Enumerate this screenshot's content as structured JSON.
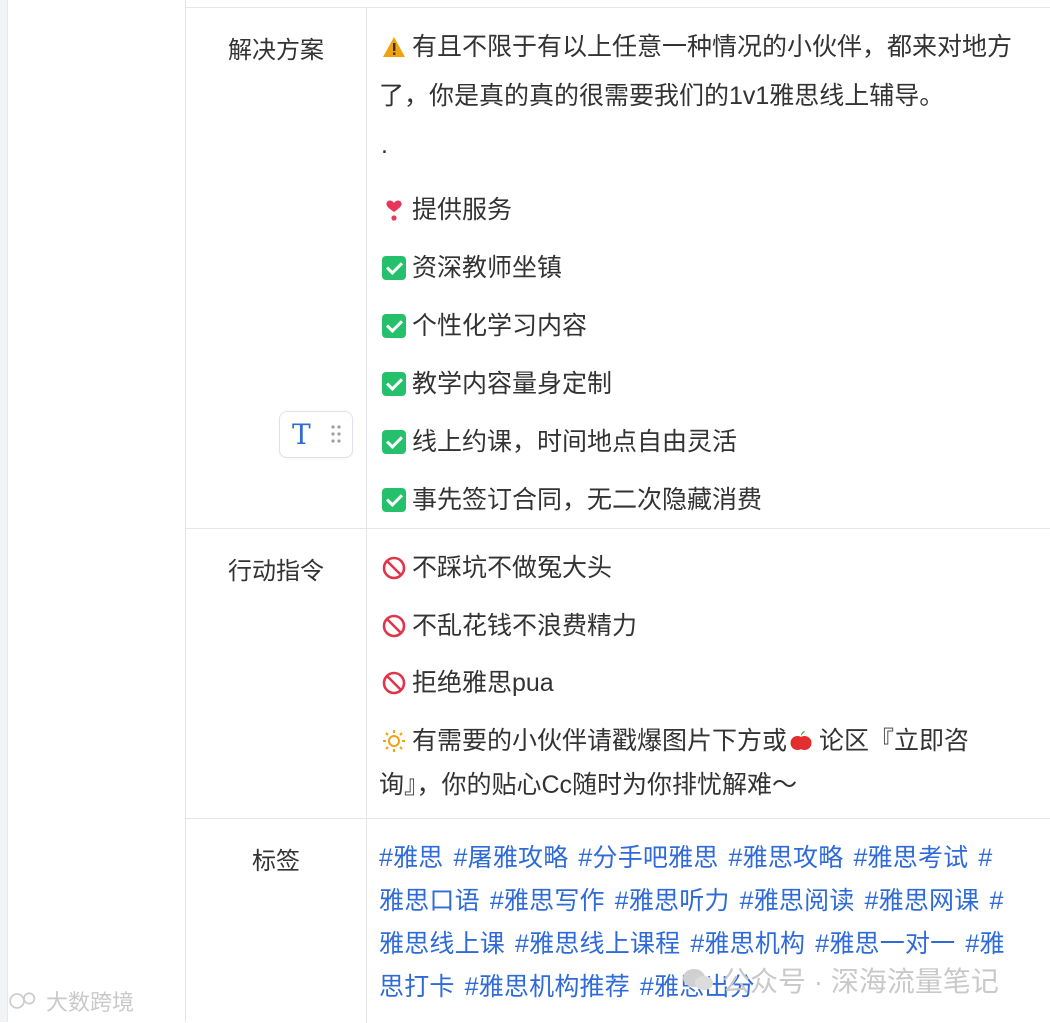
{
  "rows": [
    {
      "label": "解决方案",
      "lines": [
        {
          "emoji": "warning-icon",
          "text": "有且不限于有以上任意一种情况的小伙伴，都来对地方"
        },
        {
          "emoji": "",
          "text": "了，你是真的真的很需要我们的1v1雅思线上辅导。"
        },
        {
          "emoji": "",
          "text": "."
        },
        {
          "emoji": "heart-exclamation-icon",
          "text": "提供服务"
        },
        {
          "emoji": "check-icon",
          "text": "资深教师坐镇"
        },
        {
          "emoji": "check-icon",
          "text": "个性化学习内容"
        },
        {
          "emoji": "check-icon",
          "text": "教学内容量身定制"
        },
        {
          "emoji": "check-icon",
          "text": "线上约课，时间地点自由灵活"
        },
        {
          "emoji": "check-icon",
          "text": "事先签订合同，无二次隐藏消费"
        }
      ]
    },
    {
      "label": "行动指令",
      "lines": [
        {
          "emoji": "prohibited-icon",
          "text": "不踩坑不做冤大头"
        },
        {
          "emoji": "prohibited-icon",
          "text": "不乱花钱不浪费精力"
        },
        {
          "emoji": "prohibited-icon",
          "text": "拒绝雅思pua"
        },
        {
          "emoji": "sun-icon",
          "text": "有需要的小伙伴请戳爆图片下方或"
        },
        {
          "emoji": "",
          "text": "询』，你的贴心Cc随时为你排忧解难～"
        }
      ],
      "inline_after_sun": {
        "emoji": "apple-icon",
        "text": "论区『立即咨"
      }
    },
    {
      "label": "标签",
      "tag_lines": [
        [
          "#雅思",
          "#屠雅攻略",
          "#分手吧雅思",
          "#雅思攻略",
          "#雅思考试",
          "#"
        ],
        [
          "雅思口语",
          "#雅思写作",
          "#雅思听力",
          "#雅思阅读",
          "#雅思网课",
          "#"
        ],
        [
          "雅思线上课",
          "#雅思线上课程",
          "#雅思机构",
          "#雅思一对一",
          "#雅"
        ],
        [
          "思打卡",
          "#雅思机构推荐",
          "#雅思出分"
        ]
      ]
    }
  ],
  "toolbar": {
    "text_button": "T"
  },
  "watermarks": {
    "left": "大数跨境",
    "right": "公众号 · 深海流量笔记"
  },
  "colors": {
    "accent": "#2f6bd8",
    "border": "#e3e5e8",
    "check": "#24c06b",
    "prohibited": "#e0364b",
    "warning": "#f2a10f"
  }
}
